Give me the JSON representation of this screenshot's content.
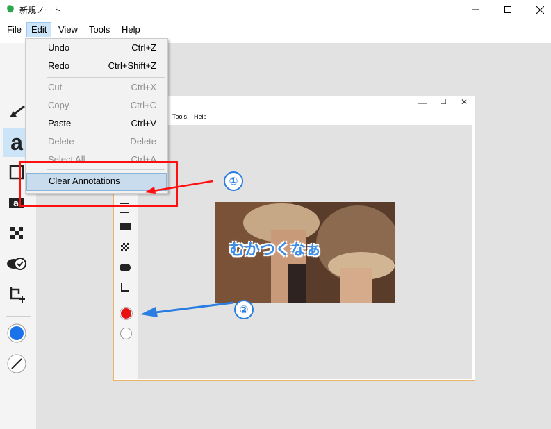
{
  "window": {
    "title": "新規ノート",
    "minimize_glyph": "—",
    "maximize_glyph": "☐",
    "close_glyph": "✕"
  },
  "menubar": {
    "items": [
      "File",
      "Edit",
      "View",
      "Tools",
      "Help"
    ],
    "active": "Edit"
  },
  "edit_menu": {
    "items": [
      {
        "label": "Undo",
        "shortcut": "Ctrl+Z",
        "enabled": true
      },
      {
        "label": "Redo",
        "shortcut": "Ctrl+Shift+Z",
        "enabled": true
      },
      {
        "label": "Cut",
        "shortcut": "Ctrl+X",
        "enabled": false
      },
      {
        "label": "Copy",
        "shortcut": "Ctrl+C",
        "enabled": false
      },
      {
        "label": "Paste",
        "shortcut": "Ctrl+V",
        "enabled": true
      },
      {
        "label": "Delete",
        "shortcut": "Delete",
        "enabled": false
      },
      {
        "label": "Select All",
        "shortcut": "Ctrl+A",
        "enabled": false
      },
      {
        "label": "Clear Annotations",
        "shortcut": "",
        "enabled": true,
        "highlighted": true
      }
    ]
  },
  "inner_window": {
    "menu_items": [
      "Tools",
      "Help"
    ],
    "image_caption": "むかつくなぁ"
  },
  "callouts": {
    "first": "①",
    "second": "②"
  },
  "colors": {
    "accent_blue": "#1f6fe8",
    "highlight_red": "#ff1010",
    "selected_tool_bg": "#cce4f7",
    "canvas_bg": "#e3e2e2",
    "color_swatch_blue": "#1a73e8",
    "color_swatch_red": "#e81010"
  },
  "tools": [
    "arrow-tool-icon",
    "text-tool-icon",
    "rectangle-tool-icon",
    "text-box-tool-icon",
    "mosaic-tool-icon",
    "stamp-tool-icon",
    "crop-tool-icon",
    "color-picker",
    "line-width-picker"
  ]
}
